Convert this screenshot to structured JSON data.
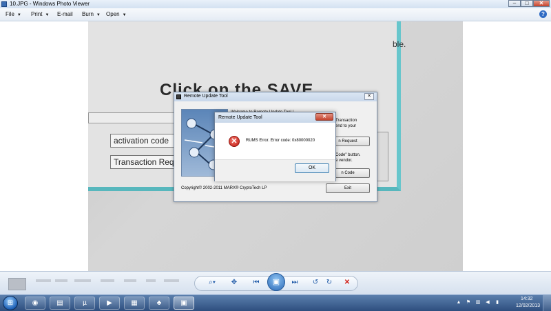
{
  "window": {
    "title": "10.JPG - Windows Photo Viewer",
    "controls": {
      "minimize": "–",
      "maximize": "□",
      "close": "✕"
    }
  },
  "menu": {
    "items": [
      {
        "label": "File",
        "has_dropdown": true
      },
      {
        "label": "Print",
        "has_dropdown": true
      },
      {
        "label": "E-mail",
        "has_dropdown": false
      },
      {
        "label": "Burn",
        "has_dropdown": true
      },
      {
        "label": "Open",
        "has_dropdown": true
      }
    ],
    "help_icon": "?"
  },
  "photo": {
    "background_text_top": "ble.",
    "background_heading": "Click on the  SAVE",
    "field_activation": "activation code",
    "field_transaction": "Transaction Req"
  },
  "remote_update_tool": {
    "title": "Remote Update Tool",
    "welcome": "Welcome to Remote Update Tool !",
    "text_lines": [
      "Transaction",
      "end to your",
      "Code\" button.",
      "e vendor."
    ],
    "buttons": {
      "request": "n Request",
      "code": "n Code",
      "exit": "Exit"
    },
    "copyright": "Copyright© 2002-2011 MARX® CryptoTech LP",
    "close_glyph": "✕"
  },
  "error_dialog": {
    "title": "Remote Update Tool",
    "message": "RUMS Error. Error code: 0x80000020",
    "ok_label": "OK",
    "close_glyph": "✕",
    "icon_glyph": "✕"
  },
  "viewer_controls": {
    "zoom": "⌕▾",
    "actual_size": "✥",
    "previous": "⏮",
    "slideshow": "▣",
    "next": "⏭",
    "rotate_ccw": "↺",
    "rotate_cw": "↻",
    "delete": "✕"
  },
  "taskbar": {
    "start_glyph": "⊞",
    "apps": [
      {
        "name": "firefox",
        "glyph": "◉"
      },
      {
        "name": "explorer",
        "glyph": "▤"
      },
      {
        "name": "utorrent",
        "glyph": "µ"
      },
      {
        "name": "media",
        "glyph": "▶"
      },
      {
        "name": "windows-explorer",
        "glyph": "▦"
      },
      {
        "name": "solitaire",
        "glyph": "♣"
      },
      {
        "name": "photo-viewer",
        "glyph": "▣"
      }
    ],
    "tray": {
      "expand": "▲",
      "flag": "⚑",
      "network": "▥",
      "volume": "◀",
      "battery": "▮"
    },
    "time": "14:32",
    "date": "12/02/2013"
  },
  "colors": {
    "titlebar": "#d3e1f1",
    "photo_accent": "#67c6cc",
    "error_red": "#c21b12",
    "taskbar": "#2e4f7f"
  }
}
